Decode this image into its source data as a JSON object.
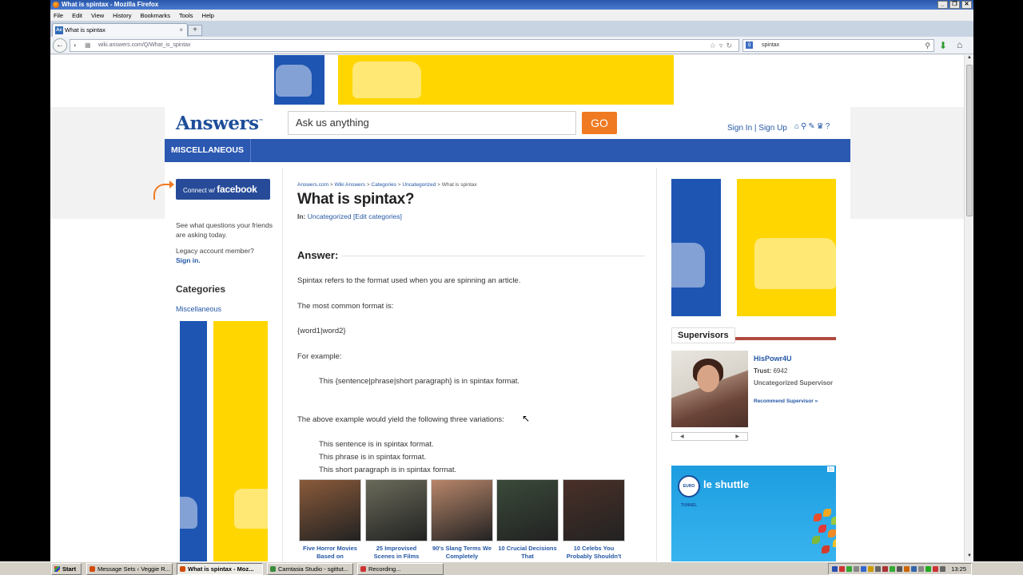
{
  "window": {
    "title": "What is spintax - Mozilla Firefox",
    "controls": [
      "_",
      "❐",
      "✕"
    ]
  },
  "menu": [
    "File",
    "Edit",
    "View",
    "History",
    "Bookmarks",
    "Tools",
    "Help"
  ],
  "tab": {
    "label": "What is spintax",
    "favicon": "Ac",
    "close": "×",
    "new_tab": "+"
  },
  "nav": {
    "back": "←",
    "url": "wiki.answers.com/Q/What_is_spintax",
    "search_value": "spintax",
    "search_engine": "g"
  },
  "site": {
    "logo": "Answers",
    "ask_placeholder": "Ask us anything",
    "go_label": "GO",
    "signin": "Sign In | Sign Up",
    "category_tab": "MISCELLANEOUS"
  },
  "left": {
    "connect_prefix": "Connect w/",
    "connect_brand": "facebook",
    "friends_text": "See what questions your friends are asking today.",
    "legacy_text": "Legacy account member?",
    "legacy_link": "Sign in.",
    "categories_heading": "Categories",
    "category_link": "Miscellaneous"
  },
  "main": {
    "breadcrumbs": [
      "Answers.com",
      "Wiki Answers",
      "Categories",
      "Uncategorized",
      "What is spintax"
    ],
    "crumb_sep": " > ",
    "title": "What is spintax?",
    "in_prefix": "In: ",
    "in_category": "Uncategorized",
    "edit_categories": "[Edit categories]",
    "answer_heading": "Answer:",
    "answer_lines": [
      "Spintax refers to the format used when you are spinning an article.",
      "The most common format is:",
      "{word1|word2}",
      "For example:",
      "This {sentence|phrase|short paragraph} is in spintax format.",
      "The above example would yield the following three variations:",
      "This sentence is in spintax format.",
      "This phrase is in spintax format.",
      "This short paragraph is in spintax format."
    ],
    "thumbs": [
      {
        "caption": "Five Horror Movies Based on",
        "color": "#8a5a3a"
      },
      {
        "caption": "25 Improvised Scenes in Films",
        "color": "#6a6a5a"
      },
      {
        "caption": "90's Slang Terms We Completely",
        "color": "#b8866a"
      },
      {
        "caption": "10 Crucial Decisions That",
        "color": "#3a4a3a"
      },
      {
        "caption": "10 Celebs You Probably Shouldn't",
        "color": "#4a3028"
      }
    ]
  },
  "right": {
    "supervisors_heading": "Supervisors",
    "name": "HisPowr4U",
    "trust_label": "Trust:",
    "trust_value": "6942",
    "role": "Uncategorized Supervisor",
    "recommend": "Recommend Supervisor »",
    "pager_prev": "◀",
    "pager_next": "▶",
    "ad_badge": "EURO TUNNEL",
    "ad_brand": "le shuttle",
    "ad_choice": "▷"
  },
  "taskbar": {
    "start": "Start",
    "tasks": [
      {
        "label": "Message Sets ‹ Veggie R...",
        "color": "#d24b07"
      },
      {
        "label": "What is spintax - Moz...",
        "color": "#d24b07",
        "active": true
      },
      {
        "label": "Camtasia Studio - sgittut...",
        "color": "#3a8a3a"
      },
      {
        "label": "Recording...",
        "color": "#c33"
      }
    ],
    "clock": "13:25",
    "tray_colors": [
      "#2a4fb0",
      "#c33",
      "#3a3",
      "#888",
      "#36c",
      "#c90",
      "#666",
      "#a33",
      "#3a3",
      "#555",
      "#c60",
      "#36a",
      "#888",
      "#2a2",
      "#c33",
      "#666"
    ]
  }
}
